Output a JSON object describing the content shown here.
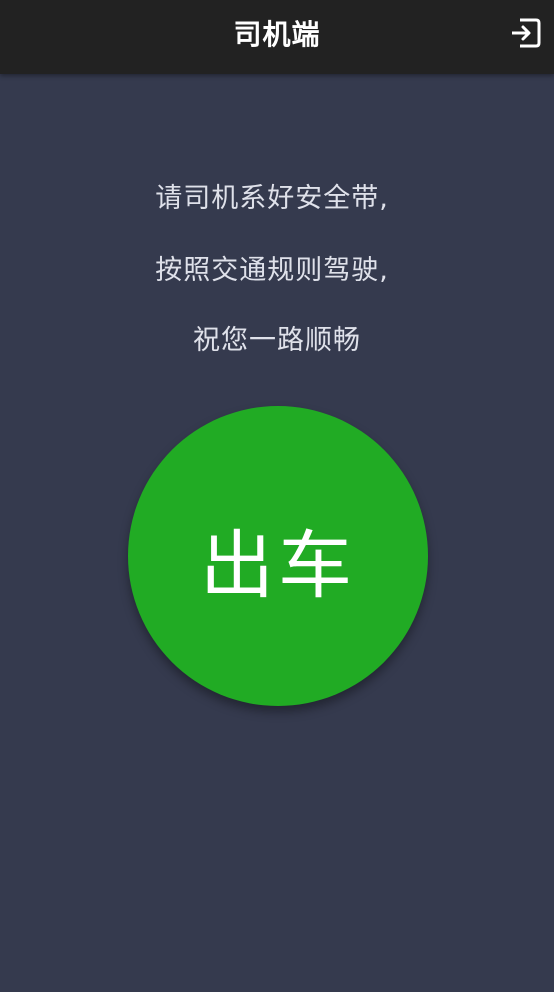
{
  "header": {
    "title": "司机端",
    "exit_icon": "exit-icon"
  },
  "message": {
    "line1": "请司机系好安全带,",
    "line2": "按照交通规则驾驶,",
    "line3": "祝您一路顺畅"
  },
  "action": {
    "depart_label": "出车"
  },
  "colors": {
    "background": "#353a4e",
    "topbar": "#222222",
    "depart_button": "#21ab24",
    "text": "#dfe1ea"
  }
}
